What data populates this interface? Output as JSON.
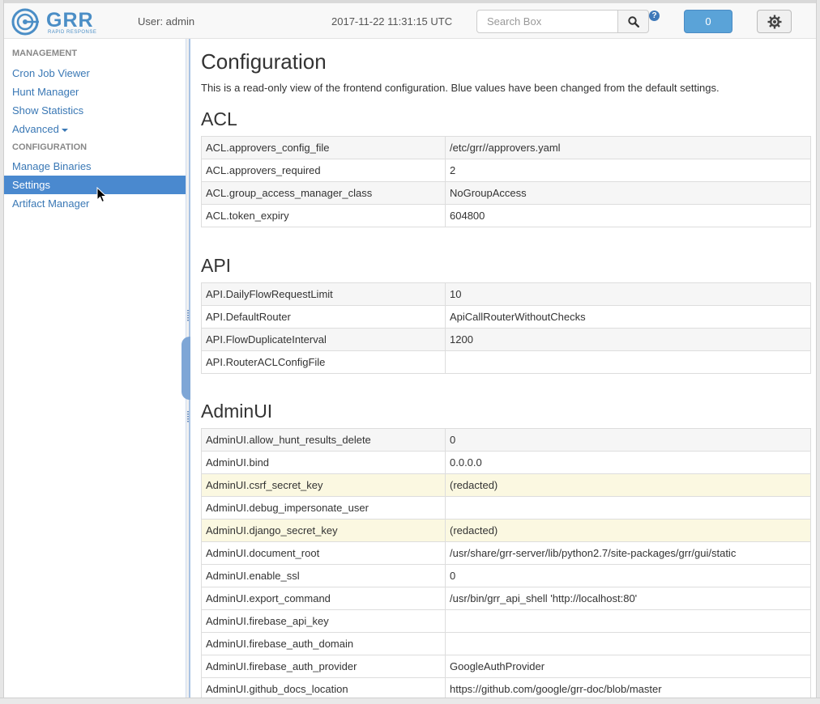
{
  "header": {
    "logo_text": "GRR",
    "logo_subtitle": "RAPID RESPONSE",
    "user_label": "User: admin",
    "timestamp": "2017-11-22 11:31:15 UTC",
    "search_placeholder": "Search Box",
    "help_icon": "?",
    "notification_count": "0"
  },
  "sidebar": {
    "management_header": "MANAGEMENT",
    "items_management": [
      {
        "label": "Cron Job Viewer"
      },
      {
        "label": "Hunt Manager"
      },
      {
        "label": "Show Statistics"
      },
      {
        "label": "Advanced"
      }
    ],
    "configuration_header": "CONFIGURATION",
    "items_configuration": [
      {
        "label": "Manage Binaries"
      },
      {
        "label": "Settings",
        "active": true
      },
      {
        "label": "Artifact Manager"
      }
    ]
  },
  "main": {
    "title": "Configuration",
    "description": "This is a read-only view of the frontend configuration. Blue values have been changed from the default settings.",
    "sections": [
      {
        "title": "ACL",
        "rows": [
          {
            "key": "ACL.approvers_config_file",
            "value": "/etc/grr//approvers.yaml"
          },
          {
            "key": "ACL.approvers_required",
            "value": "2"
          },
          {
            "key": "ACL.group_access_manager_class",
            "value": "NoGroupAccess"
          },
          {
            "key": "ACL.token_expiry",
            "value": "604800"
          }
        ]
      },
      {
        "title": "API",
        "rows": [
          {
            "key": "API.DailyFlowRequestLimit",
            "value": "10"
          },
          {
            "key": "API.DefaultRouter",
            "value": "ApiCallRouterWithoutChecks"
          },
          {
            "key": "API.FlowDuplicateInterval",
            "value": "1200"
          },
          {
            "key": "API.RouterACLConfigFile",
            "value": ""
          }
        ]
      },
      {
        "title": "AdminUI",
        "rows": [
          {
            "key": "AdminUI.allow_hunt_results_delete",
            "value": "0"
          },
          {
            "key": "AdminUI.bind",
            "value": "0.0.0.0"
          },
          {
            "key": "AdminUI.csrf_secret_key",
            "value": "(redacted)",
            "highlight": true
          },
          {
            "key": "AdminUI.debug_impersonate_user",
            "value": ""
          },
          {
            "key": "AdminUI.django_secret_key",
            "value": "(redacted)",
            "highlight": true
          },
          {
            "key": "AdminUI.document_root",
            "value": "/usr/share/grr-server/lib/python2.7/site-packages/grr/gui/static"
          },
          {
            "key": "AdminUI.enable_ssl",
            "value": "0"
          },
          {
            "key": "AdminUI.export_command",
            "value": "/usr/bin/grr_api_shell 'http://localhost:80'"
          },
          {
            "key": "AdminUI.firebase_api_key",
            "value": ""
          },
          {
            "key": "AdminUI.firebase_auth_domain",
            "value": ""
          },
          {
            "key": "AdminUI.firebase_auth_provider",
            "value": "GoogleAuthProvider"
          },
          {
            "key": "AdminUI.github_docs_location",
            "value": "https://github.com/google/grr-doc/blob/master"
          }
        ]
      }
    ]
  },
  "colors": {
    "accent": "#4a89cf",
    "link": "#3a78b5",
    "highlight_row": "#fbf8e1",
    "notification_button": "#5aa3d8"
  }
}
